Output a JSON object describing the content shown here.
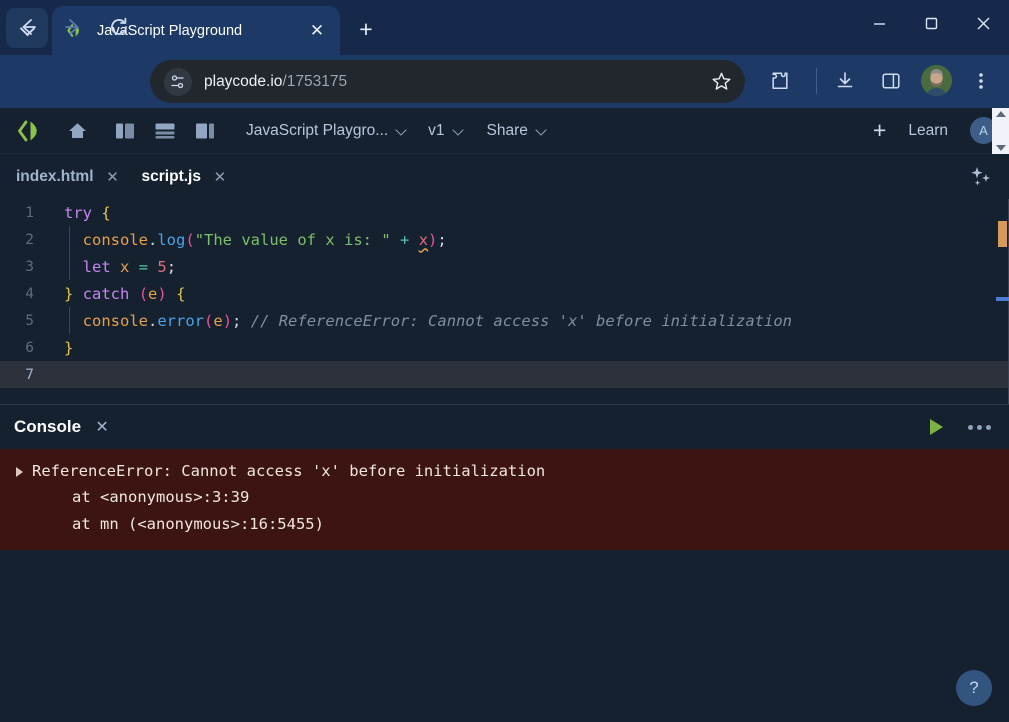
{
  "browser": {
    "tab": {
      "title": "JavaScript Playground",
      "favicon": "code-playground-favicon",
      "close_label": "✕"
    },
    "new_tab_label": "+",
    "tabstrip_menu": "tab-search-icon",
    "window": {
      "minimize": "—",
      "maximize": "□",
      "close": "✕"
    },
    "nav": {
      "back": "←",
      "forward": "→",
      "reload": "⟳"
    },
    "omnibox": {
      "site_settings_icon": "page-settings-icon",
      "url_host": "playcode.io",
      "url_path": "/1753175",
      "bookmark_icon": "star-icon"
    },
    "toolbar_icons": [
      "extensions-icon",
      "downloads-icon",
      "side-panel-icon",
      "profile-avatar",
      "browser-menu-icon"
    ]
  },
  "app": {
    "logo": "playcode-logo",
    "home": "home-icon",
    "layouts": [
      "layout-split-left",
      "layout-split-horizontal",
      "layout-split-right"
    ],
    "project_name": "JavaScript Playgro...",
    "version": "v1",
    "share": "Share",
    "add_label": "+",
    "learn": "Learn",
    "user_initial": "A",
    "sparkle_icon": "ai-sparkle-icon"
  },
  "files": {
    "tabs": [
      {
        "name": "index.html",
        "active": false,
        "close": "✕"
      },
      {
        "name": "script.js",
        "active": true,
        "close": "✕"
      }
    ]
  },
  "editor": {
    "language": "javascript",
    "active_line": 7,
    "line_numbers": [
      "1",
      "2",
      "3",
      "4",
      "5",
      "6",
      "7"
    ],
    "lines": [
      "try {",
      "  console.log(\"The value of x is: \" + x);",
      "  let x = 5;",
      "} catch (e) {",
      "  console.error(e); // ReferenceError: Cannot access 'x' before initialization",
      "}",
      ""
    ],
    "markers": {
      "warning": "warning-marker",
      "info": "info-marker"
    }
  },
  "console": {
    "title": "Console",
    "close": "✕",
    "run_icon": "run-play-icon",
    "more_icon": "more-options-icon",
    "error": {
      "message": "ReferenceError: Cannot access 'x' before initialization",
      "stack": [
        "at <anonymous>:3:39",
        "at mn (<anonymous>:16:5455)"
      ],
      "expander": "disclosure-triangle"
    }
  },
  "help": {
    "label": "?"
  },
  "colors": {
    "browser_chrome": "#1d3a66",
    "titlebar": "#16294a",
    "app_bg": "#16212f",
    "error_bg": "#3c1512",
    "accent_green": "#7cb342",
    "active_line": "#2c313c"
  }
}
